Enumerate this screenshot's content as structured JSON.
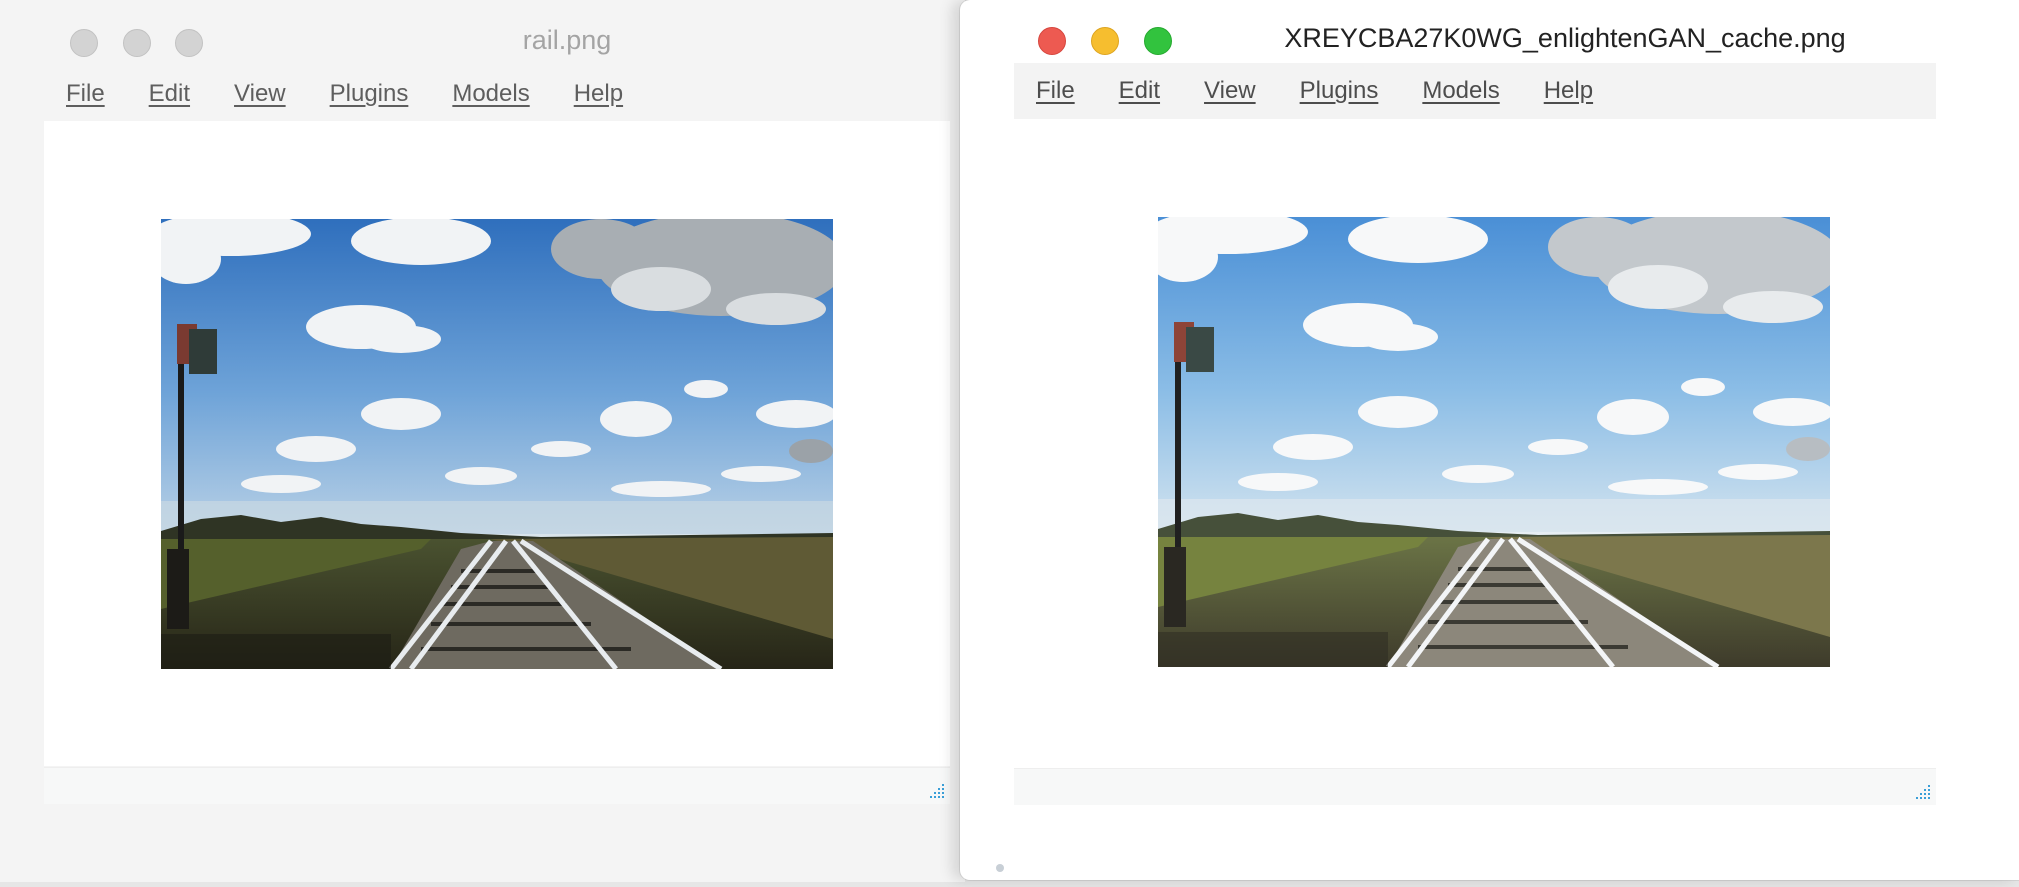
{
  "windows": {
    "left": {
      "title": "rail.png",
      "menu": [
        "File",
        "Edit",
        "View",
        "Plugins",
        "Models",
        "Help"
      ],
      "image_alt": "rail.png",
      "focused": false
    },
    "right": {
      "title": "XREYCBA27K0WG_enlightenGAN_cache.png",
      "menu": [
        "File",
        "Edit",
        "View",
        "Plugins",
        "Models",
        "Help"
      ],
      "image_alt": "XREYCBA27K0WG_enlightenGAN_cache.png",
      "focused": true
    }
  },
  "colors": {
    "close": "#ed5a51",
    "minimize": "#f6be2f",
    "zoom": "#32c33e",
    "inactive_light": "#d3d3d3",
    "resize_grip": "#3a9fd8"
  },
  "icons": {
    "resize_grip": "resize-grip-icon"
  }
}
